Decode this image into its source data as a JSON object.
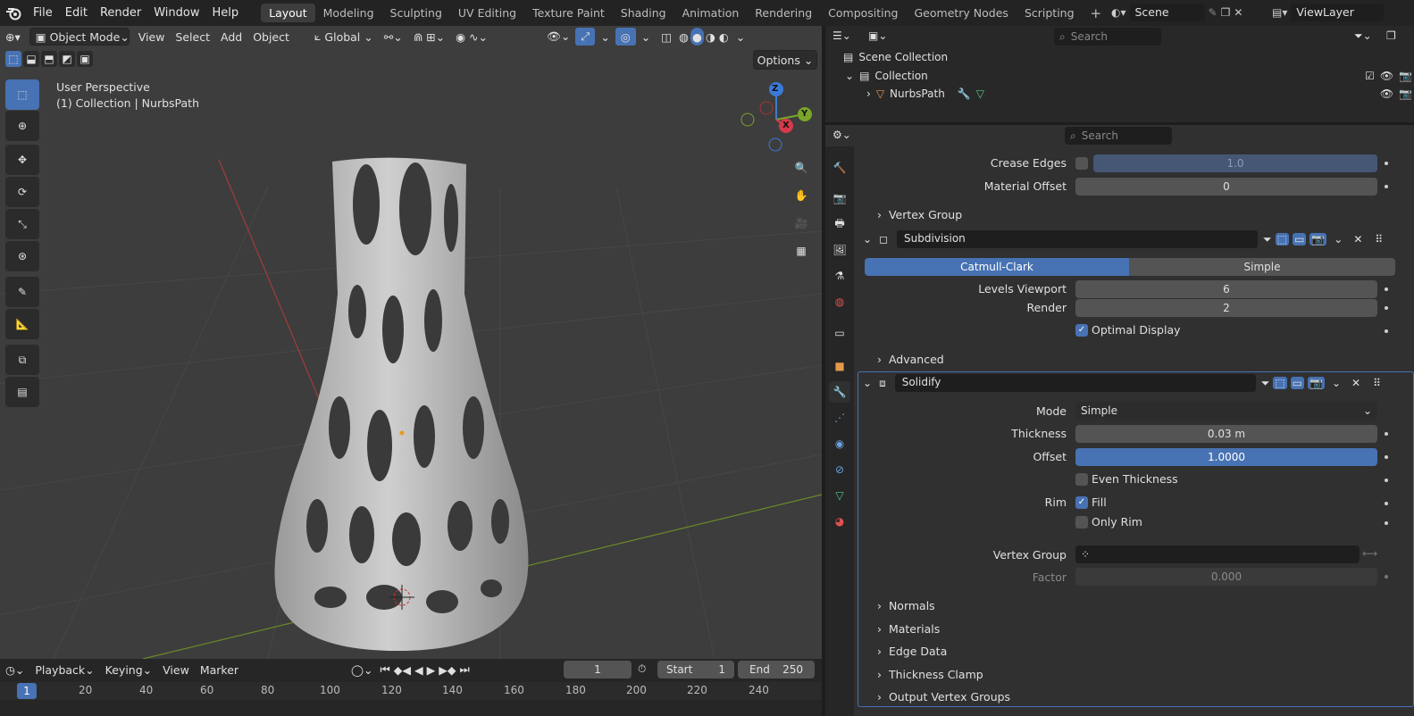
{
  "topbar": {
    "menus": [
      "File",
      "Edit",
      "Render",
      "Window",
      "Help"
    ],
    "workspaces": [
      "Layout",
      "Modeling",
      "Sculpting",
      "UV Editing",
      "Texture Paint",
      "Shading",
      "Animation",
      "Rendering",
      "Compositing",
      "Geometry Nodes",
      "Scripting"
    ],
    "active_workspace": "Layout",
    "add_tab": "+",
    "scene": "Scene",
    "view_layer": "ViewLayer"
  },
  "viewport": {
    "mode": "Object Mode",
    "menus": [
      "View",
      "Select",
      "Add",
      "Object"
    ],
    "orientation": "Global",
    "options": "Options",
    "info_line1": "User Perspective",
    "info_line2": "(1) Collection | NurbsPath",
    "gizmo": {
      "z": "Z",
      "y": "Y",
      "x": "X"
    }
  },
  "timeline": {
    "menus": [
      "Playback",
      "Keying",
      "View",
      "Marker"
    ],
    "current_frame": "1",
    "start_label": "Start",
    "start": "1",
    "end_label": "End",
    "end": "250",
    "ruler": [
      "20",
      "40",
      "60",
      "80",
      "100",
      "120",
      "140",
      "160",
      "180",
      "200",
      "220",
      "240"
    ],
    "ruler_current": "1"
  },
  "outliner": {
    "search_placeholder": "Search",
    "scene_collection": "Scene Collection",
    "collection": "Collection",
    "object": "NurbsPath"
  },
  "properties": {
    "search_placeholder": "Search",
    "crease_edges_label": "Crease Edges",
    "crease_edges": "1.0",
    "material_offset_label": "Material Offset",
    "material_offset": "0",
    "vertex_group_panel": "Vertex Group",
    "subdivision": {
      "name": "Subdivision",
      "tab_catmull": "Catmull-Clark",
      "tab_simple": "Simple",
      "levels_viewport_label": "Levels Viewport",
      "levels_viewport": "6",
      "render_label": "Render",
      "render": "2",
      "optimal_display": "Optimal Display",
      "advanced": "Advanced"
    },
    "solidify": {
      "name": "Solidify",
      "mode_label": "Mode",
      "mode": "Simple",
      "thickness_label": "Thickness",
      "thickness": "0.03 m",
      "offset_label": "Offset",
      "offset": "1.0000",
      "even_thickness": "Even Thickness",
      "rim_label": "Rim",
      "fill": "Fill",
      "only_rim": "Only Rim",
      "vertex_group_label": "Vertex Group",
      "factor_label": "Factor",
      "factor": "0.000",
      "panels": [
        "Normals",
        "Materials",
        "Edge Data",
        "Thickness Clamp",
        "Output Vertex Groups"
      ]
    }
  },
  "colors": {
    "accent": "#4772b3",
    "viewport_bg": "#3d3d3d",
    "panel_bg": "#303030"
  }
}
